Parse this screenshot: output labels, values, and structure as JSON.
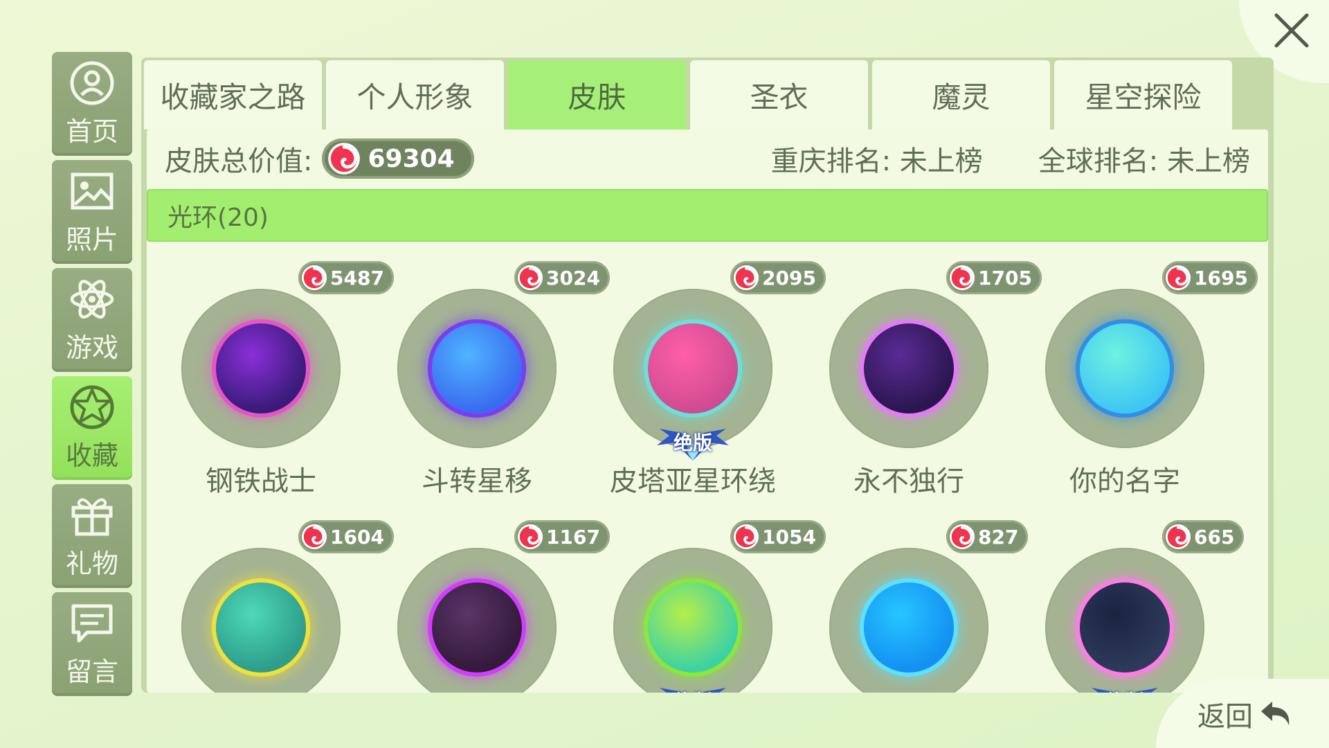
{
  "window": {
    "close_icon": "close-icon",
    "back_label": "返回"
  },
  "sidebar": {
    "items": [
      {
        "label": "首页",
        "icon": "home-person-icon",
        "active": false
      },
      {
        "label": "照片",
        "icon": "photo-icon",
        "active": false
      },
      {
        "label": "游戏",
        "icon": "atom-icon",
        "active": false
      },
      {
        "label": "收藏",
        "icon": "star-collection-icon",
        "active": true
      },
      {
        "label": "礼物",
        "icon": "gift-icon",
        "active": false
      },
      {
        "label": "留言",
        "icon": "message-icon",
        "active": false
      }
    ]
  },
  "tabs": [
    {
      "label": "收藏家之路",
      "active": false
    },
    {
      "label": "个人形象",
      "active": false
    },
    {
      "label": "皮肤",
      "active": true
    },
    {
      "label": "圣衣",
      "active": false
    },
    {
      "label": "魔灵",
      "active": false
    },
    {
      "label": "星空探险",
      "active": false
    }
  ],
  "stats": {
    "total_label": "皮肤总价值:",
    "total_value": "69304",
    "city_rank": "重庆排名: 未上榜",
    "global_rank": "全球排名: 未上榜"
  },
  "category": {
    "label": "光环(20)"
  },
  "items": [
    {
      "name": "钢铁战士",
      "price": "5487",
      "badge": "",
      "colors": [
        "#8a2fd8",
        "#3a1b7a",
        "#e455c8"
      ]
    },
    {
      "name": "斗转星移",
      "price": "3024",
      "badge": "",
      "colors": [
        "#4fb4ff",
        "#3a6cf0",
        "#7a3df2"
      ]
    },
    {
      "name": "皮塔亚星环绕",
      "price": "2095",
      "badge": "绝版",
      "colors": [
        "#ff5fa8",
        "#d04c92",
        "#6be0d8"
      ]
    },
    {
      "name": "永不独行",
      "price": "1705",
      "badge": "",
      "colors": [
        "#5a2b95",
        "#2b1650",
        "#e27cf5"
      ]
    },
    {
      "name": "你的名字",
      "price": "1695",
      "badge": "",
      "colors": [
        "#6ff2e0",
        "#3fc7f3",
        "#2f8fe8"
      ]
    },
    {
      "name": "",
      "price": "1604",
      "badge": "",
      "colors": [
        "#4fd8b8",
        "#2d9e8a",
        "#f0e03a"
      ]
    },
    {
      "name": "",
      "price": "1167",
      "badge": "",
      "colors": [
        "#5a3566",
        "#341a3c",
        "#d43cff"
      ]
    },
    {
      "name": "",
      "price": "1054",
      "badge": "绝版",
      "colors": [
        "#b6ef4a",
        "#3ed2a2",
        "#8ae83c"
      ]
    },
    {
      "name": "",
      "price": "827",
      "badge": "",
      "colors": [
        "#27c6ff",
        "#1490f2",
        "#5ee0ff"
      ]
    },
    {
      "name": "",
      "price": "665",
      "badge": "绝版",
      "colors": [
        "#1b2340",
        "#2d3a5a",
        "#ff7ce6"
      ]
    }
  ]
}
